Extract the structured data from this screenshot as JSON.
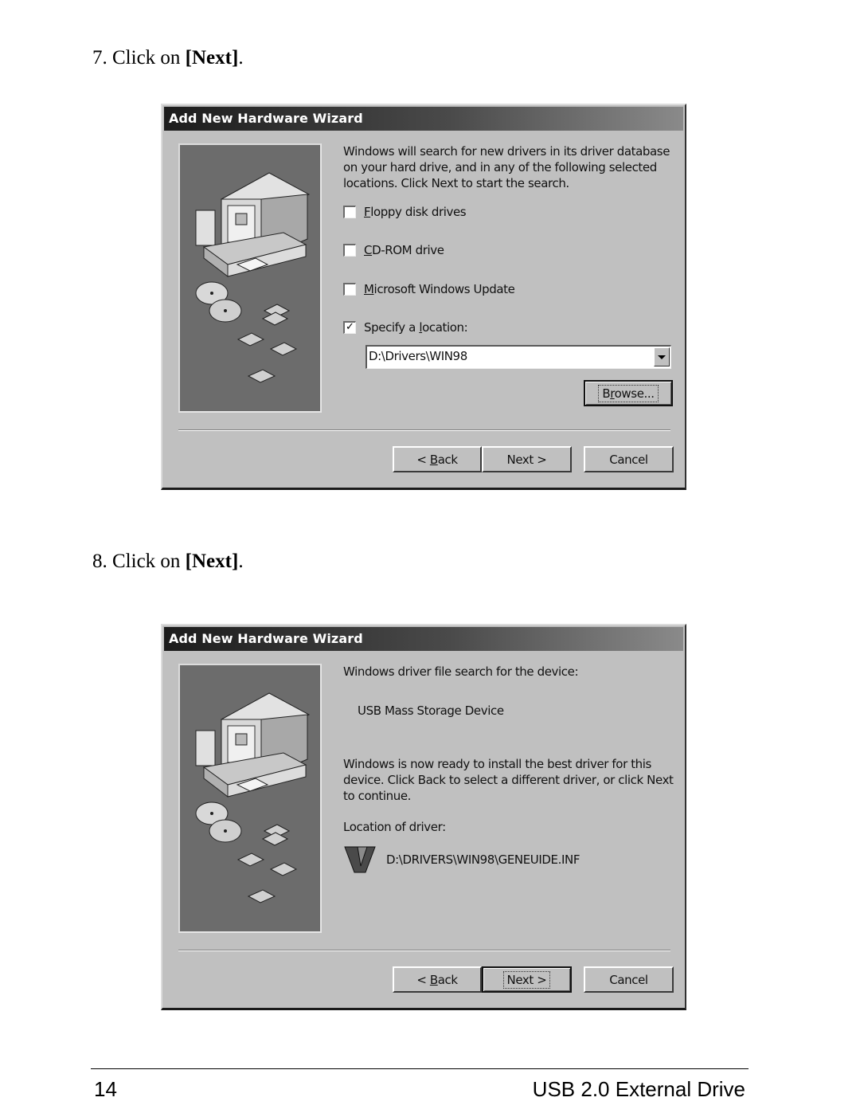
{
  "steps": [
    {
      "number": "7.",
      "text": "Click on ",
      "bold": "[Next]",
      "trail": "."
    },
    {
      "number": "8.",
      "text": "Click on ",
      "bold": "[Next]",
      "trail": "."
    }
  ],
  "dialog1": {
    "title": "Add New Hardware Wizard",
    "intro": "Windows will search for new drivers in its driver database on your hard drive, and in any of the following selected locations. Click Next to start the search.",
    "checkboxes": [
      {
        "label_ul": "F",
        "label_rest": "loppy disk drives",
        "checked": false
      },
      {
        "label_ul": "C",
        "label_rest": "D-ROM drive",
        "checked": false
      },
      {
        "label_ul": "M",
        "label_rest": "icrosoft Windows Update",
        "checked": false
      },
      {
        "label_pre": "Specify a ",
        "label_ul": "l",
        "label_rest": "ocation:",
        "checked": true
      }
    ],
    "check_mark": "✓",
    "location_value": "D:\\Drivers\\WIN98",
    "browse": {
      "pre": "B",
      "ul": "r",
      "rest": "owse..."
    },
    "buttons": {
      "back_pre": "< ",
      "back_ul": "B",
      "back_rest": "ack",
      "next": "Next >",
      "cancel": "Cancel"
    }
  },
  "dialog2": {
    "title": "Add New Hardware Wizard",
    "search_label": "Windows driver file search for the device:",
    "device_name": "USB Mass Storage Device",
    "ready_text": "Windows is now ready to install the best driver for this device. Click Back to select a different driver, or click Next to continue.",
    "location_label": "Location of driver:",
    "driver_path": "D:\\DRIVERS\\WIN98\\GENEUIDE.INF",
    "buttons": {
      "back_pre": "< ",
      "back_ul": "B",
      "back_rest": "ack",
      "next": "Next >",
      "cancel": "Cancel"
    }
  },
  "footer": {
    "page_number": "14",
    "doc_title": "USB 2.0 External Drive"
  }
}
